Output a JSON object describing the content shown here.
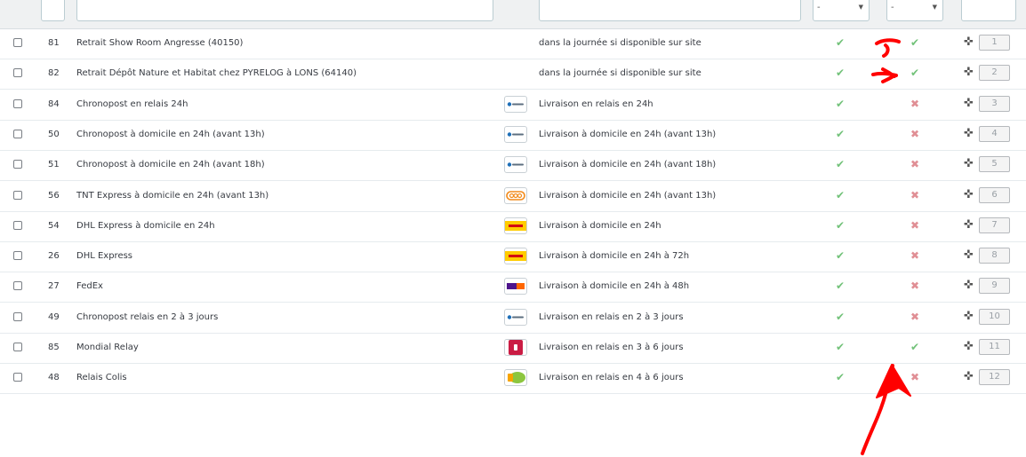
{
  "filters": {
    "dash_left": "--",
    "dash_mid": "--",
    "active_value": "-",
    "free_value": "-"
  },
  "rows": [
    {
      "id": "81",
      "name": "Retrait Show Room Angresse (40150)",
      "logo": "",
      "delay": "dans la journée si disponible sur site",
      "active": "check",
      "free": "check",
      "position": "1"
    },
    {
      "id": "82",
      "name": "Retrait Dépôt Nature et Habitat chez PYRELOG à LONS (64140)",
      "logo": "",
      "delay": "dans la journée si disponible sur site",
      "active": "check",
      "free": "check",
      "position": "2"
    },
    {
      "id": "84",
      "name": "Chronopost en relais 24h",
      "logo": "chronopost",
      "delay": "Livraison en relais en 24h",
      "active": "check",
      "free": "cross",
      "position": "3"
    },
    {
      "id": "50",
      "name": "Chronopost à domicile en 24h (avant 13h)",
      "logo": "chronopost",
      "delay": "Livraison à domicile en 24h (avant 13h)",
      "active": "check",
      "free": "cross",
      "position": "4"
    },
    {
      "id": "51",
      "name": "Chronopost à domicile en 24h (avant 18h)",
      "logo": "chronopost",
      "delay": "Livraison à domicile en 24h (avant 18h)",
      "active": "check",
      "free": "cross",
      "position": "5"
    },
    {
      "id": "56",
      "name": "TNT Express à domicile en 24h (avant 13h)",
      "logo": "tnt",
      "delay": "Livraison à domicile en 24h (avant 13h)",
      "active": "check",
      "free": "cross",
      "position": "6"
    },
    {
      "id": "54",
      "name": "DHL Express à domicile en 24h",
      "logo": "dhl",
      "delay": "Livraison à domicile en 24h",
      "active": "check",
      "free": "cross",
      "position": "7"
    },
    {
      "id": "26",
      "name": "DHL Express",
      "logo": "dhl",
      "delay": "Livraison à domicile en 24h à 72h",
      "active": "check",
      "free": "cross",
      "position": "8"
    },
    {
      "id": "27",
      "name": "FedEx",
      "logo": "fedex",
      "delay": "Livraison à domicile en 24h à 48h",
      "active": "check",
      "free": "cross",
      "position": "9"
    },
    {
      "id": "49",
      "name": "Chronopost relais en 2 à 3 jours",
      "logo": "chronopost",
      "delay": "Livraison en relais en 2 à 3 jours",
      "active": "check",
      "free": "cross",
      "position": "10"
    },
    {
      "id": "85",
      "name": "Mondial Relay",
      "logo": "mondialrelay",
      "delay": "Livraison en relais en 3 à 6 jours",
      "active": "check",
      "free": "check",
      "position": "11"
    },
    {
      "id": "48",
      "name": "Relais Colis",
      "logo": "relaiscolis",
      "delay": "Livraison en relais en 4 à 6 jours",
      "active": "check",
      "free": "cross",
      "position": "12"
    }
  ],
  "icons": {
    "check": "check-icon",
    "cross": "cross-icon",
    "move": "move-icon"
  },
  "colors": {
    "check": "#72c279",
    "cross": "#e08f95",
    "annotation": "#ff0000"
  }
}
